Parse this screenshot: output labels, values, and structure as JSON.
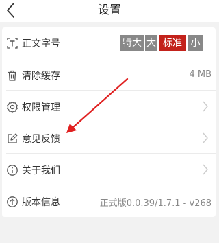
{
  "nav": {
    "title": "设置",
    "back_icon": "chevron-left-icon"
  },
  "settings": {
    "font_size": {
      "label": "正文字号",
      "icon": "text-size-icon",
      "options": [
        "特大",
        "大",
        "标准",
        "小"
      ],
      "selected": "标准"
    },
    "clear_cache": {
      "label": "清除缓存",
      "icon": "trash-icon",
      "value": "4 MB"
    },
    "permissions": {
      "label": "权限管理",
      "icon": "gear-icon"
    },
    "feedback": {
      "label": "意见反馈",
      "icon": "edit-icon"
    },
    "about": {
      "label": "关于我们",
      "icon": "info-icon"
    },
    "version": {
      "label": "版本信息",
      "icon": "upload-circle-icon",
      "value": "正式版0.0.39/1.7.1 - v268"
    }
  },
  "colors": {
    "accent": "#c3221b",
    "option_inactive": "#888888",
    "annotation_arrow": "#e02020"
  }
}
